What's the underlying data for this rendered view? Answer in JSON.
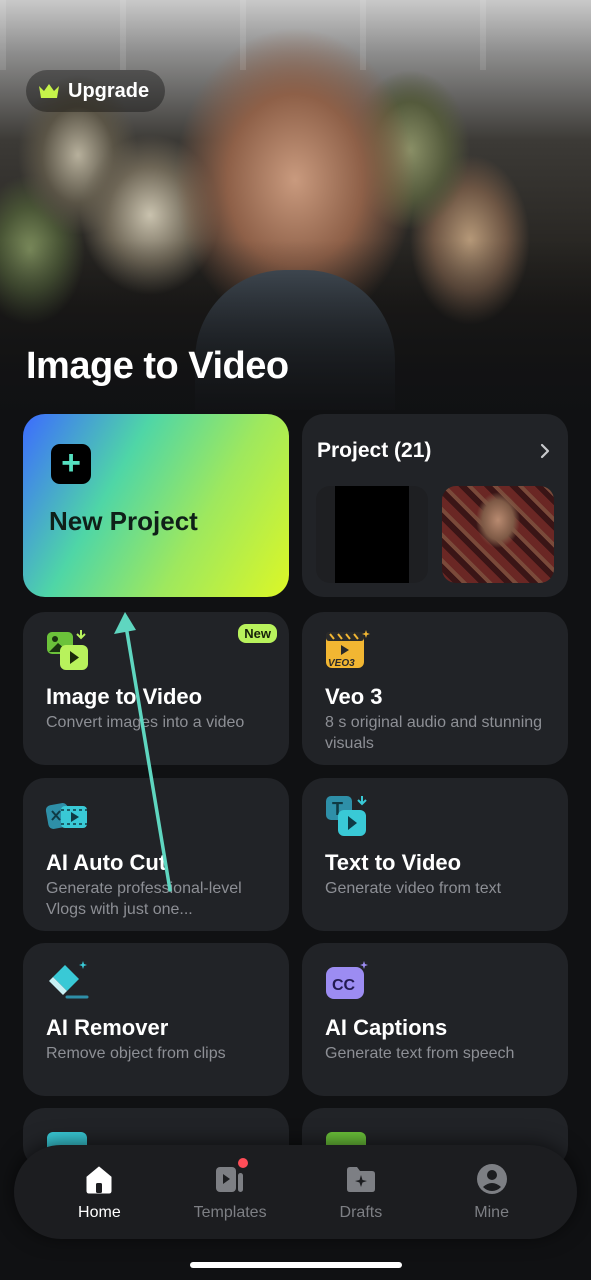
{
  "hero": {
    "upgrade_label": "Upgrade",
    "title": "Image to Video"
  },
  "new_project": {
    "label": "New Project"
  },
  "project": {
    "title": "Project (21)"
  },
  "features": [
    {
      "title": "Image to Video",
      "subtitle": "Convert images into a video",
      "badge": "New",
      "icon": "image-to-video-icon"
    },
    {
      "title": "Veo 3",
      "subtitle": "8 s original audio and stunning visuals",
      "icon": "veo3-icon"
    },
    {
      "title": "AI Auto Cut",
      "subtitle": "Generate professional-level Vlogs with just one...",
      "icon": "auto-cut-icon"
    },
    {
      "title": "Text to Video",
      "subtitle": "Generate video from text",
      "icon": "text-to-video-icon"
    },
    {
      "title": "AI Remover",
      "subtitle": "Remove object from clips",
      "icon": "eraser-icon"
    },
    {
      "title": "AI Captions",
      "subtitle": "Generate text from speech",
      "icon": "captions-icon"
    }
  ],
  "tabs": [
    {
      "label": "Home",
      "icon": "home-icon",
      "active": true
    },
    {
      "label": "Templates",
      "icon": "templates-icon"
    },
    {
      "label": "Drafts",
      "icon": "drafts-icon"
    },
    {
      "label": "Mine",
      "icon": "profile-icon"
    }
  ],
  "colors": {
    "accent_green": "#b8f25c",
    "teal_icon": "#39c9d6",
    "card_bg": "#212327",
    "badge_red": "#ff4d58"
  }
}
